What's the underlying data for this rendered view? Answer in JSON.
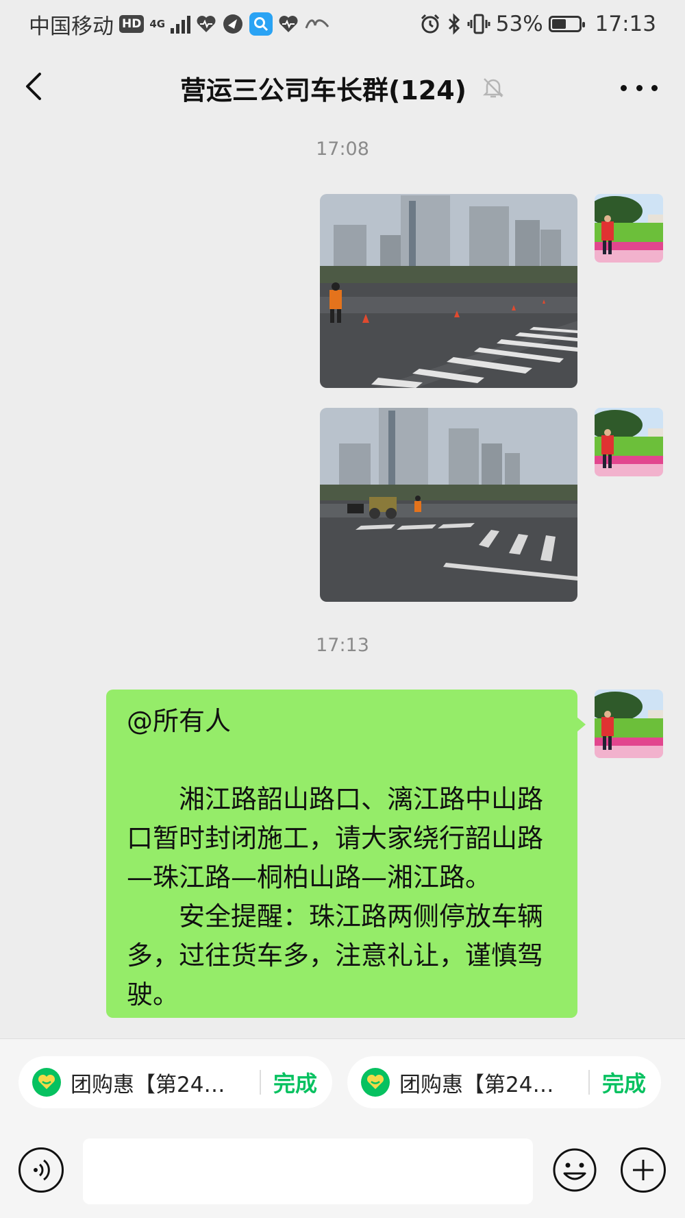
{
  "status_bar": {
    "carrier": "中国移动",
    "hd": "HD",
    "network": "4G",
    "battery_percent": "53%",
    "battery_level": 0.53,
    "time": "17:13",
    "icons": [
      "heart-rate-icon",
      "bird-app-icon",
      "search-app-icon",
      "heart-rate-icon",
      "xuexi-app-icon",
      "alarm-icon",
      "bluetooth-icon",
      "vibrate-icon",
      "battery-icon"
    ]
  },
  "nav": {
    "title": "营运三公司车长群(124)",
    "muted": true
  },
  "messages": [
    {
      "type": "timestamp",
      "text": "17:08"
    },
    {
      "type": "image",
      "sender": "self",
      "scene": "street intersection crosswalk with high-rise buildings and traffic cones"
    },
    {
      "type": "image",
      "sender": "self",
      "scene": "intersection under construction with roller and workers"
    },
    {
      "type": "timestamp",
      "text": "17:13"
    },
    {
      "type": "text",
      "sender": "self",
      "mention": "@所有人",
      "paragraph1": "湘江路韶山路口、漓江路中山路口暂时封闭施工，请大家绕行韶山路—珠江路—桐柏山路—湘江路。",
      "paragraph2": "安全提醒：珠江路两侧停放车辆多，过往货车多，注意礼让，谨慎驾驶。"
    }
  ],
  "quick_chips": [
    {
      "label": "团购惠【第24…",
      "action": "完成"
    },
    {
      "label": "团购惠【第24…",
      "action": "完成"
    }
  ],
  "colors": {
    "bubble": "#95ec69",
    "accent": "#07c160",
    "background": "#ededed"
  }
}
